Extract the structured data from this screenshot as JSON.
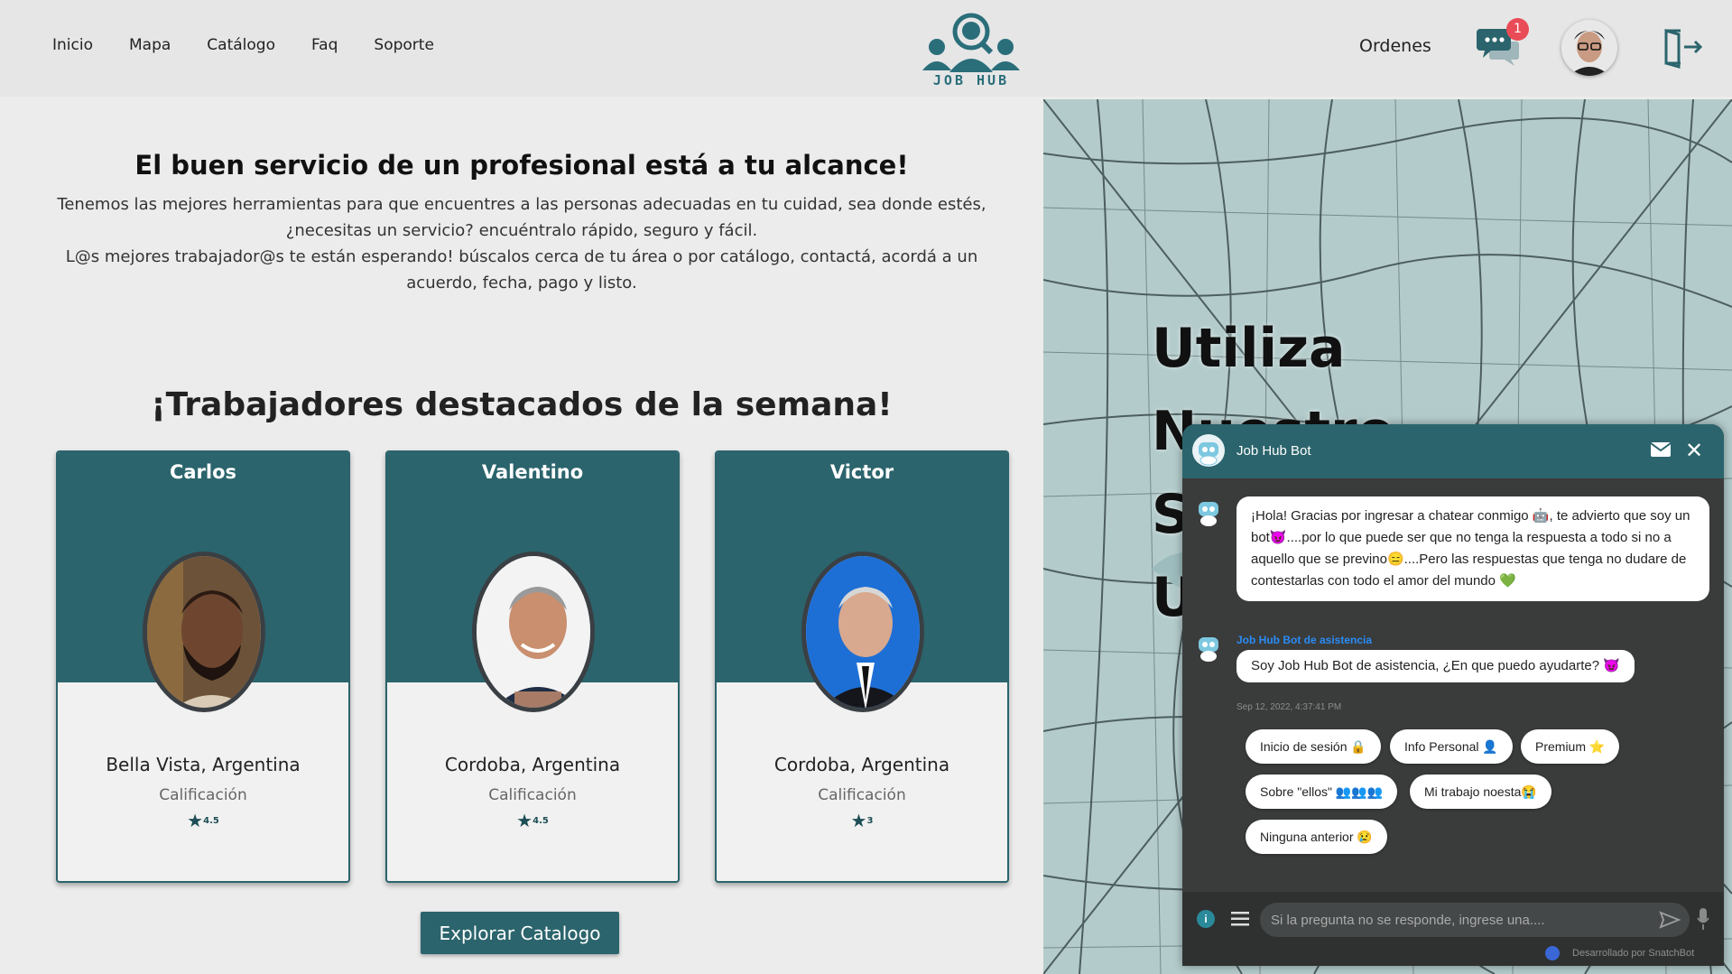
{
  "nav": {
    "items": [
      "Inicio",
      "Mapa",
      "Catálogo",
      "Faq",
      "Soporte"
    ]
  },
  "logo": {
    "text": "JOB HUB"
  },
  "header": {
    "orders_label": "Ordenes",
    "notification_count": "1"
  },
  "hero": {
    "title": "El buen servicio de un profesional está a tu alcance!",
    "line1": "Tenemos las mejores herramientas para que encuentres a las personas adecuadas en tu cuidad, sea donde estés, ¿necesitas un servicio? encuéntralo rápido, seguro y fácil.",
    "line2": "L@s mejores trabajador@s te están esperando! búscalos cerca de tu área o por catálogo, contactá, acordá a un acuerdo, fecha, pago y listo."
  },
  "featured": {
    "title": "¡Trabajadores destacados de la semana!",
    "workers": [
      {
        "name": "Carlos",
        "location": "Bella Vista, Argentina",
        "rating_label": "Calificación",
        "rating": "4.5"
      },
      {
        "name": "Valentino",
        "location": "Cordoba, Argentina",
        "rating_label": "Calificación",
        "rating": "4.5"
      },
      {
        "name": "Victor",
        "location": "Cordoba, Argentina",
        "rating_label": "Calificación",
        "rating": "3"
      }
    ],
    "explore_button": "Explorar Catalogo"
  },
  "map_panel": {
    "heading": "Utiliza Nuestro Sistema De B U"
  },
  "chatbot": {
    "title": "Job Hub Bot",
    "message1": "¡Hola! Gracias por ingresar a chatear conmigo 🤖, te advierto que soy un bot😈....por lo que puede ser que no tenga la respuesta a todo si no a aquello que se previno😑....Pero las respuestas que tenga no dudare de contestarlas con todo el amor del mundo 💚",
    "bot_label": "Job Hub Bot de asistencia",
    "message2": "Soy Job Hub Bot de asistencia, ¿En que puedo ayudarte? 😈",
    "timestamp": "Sep 12, 2022, 4:37:41 PM",
    "quick_replies": [
      "Inicio de sesión 🔒",
      "Info Personal 👤",
      "Premium ⭐",
      "Sobre \"ellos\" 👥👥👥",
      "Mi trabajo noesta😭",
      "Ninguna anterior 😢"
    ],
    "input_placeholder": "Si la pregunta no se responde, ingrese una....",
    "powered_by": "Desarrollado por SnatchBot"
  },
  "colors": {
    "primary": "#2b646c",
    "header_bg": "#e6e6e6",
    "page_bg": "#ececec",
    "badge": "#e94b57",
    "chat_bg": "#3a3c3c"
  }
}
